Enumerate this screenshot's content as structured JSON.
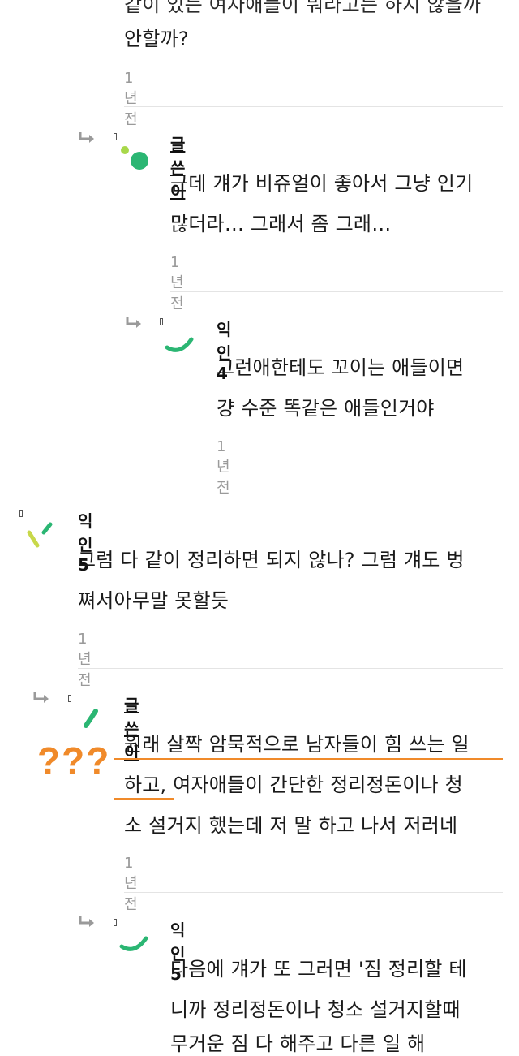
{
  "comment_top": {
    "lines": [
      "같이 있는 여자애들이 뭐라고는 하지 않을까",
      "안할까?"
    ],
    "time": "1년전"
  },
  "reply_1": {
    "author": "글쓴이",
    "lines": [
      "근데 걔가 비쥬얼이 좋아서 그냥 인기",
      "많더라… 그래서 좀 그래…"
    ],
    "time": "1년전"
  },
  "reply_2": {
    "author": "익인4",
    "lines": [
      "그런애한테도 꼬이는 애들이면",
      "걍 수준 똑같은 애들인거야"
    ],
    "time": "1년전"
  },
  "comment_5": {
    "author": "익인5",
    "lines": [
      "그럼 다 같이 정리하면 되지 않나? 그럼 걔도 벙",
      "쪄서아무말 못할듯"
    ],
    "time": "1년전"
  },
  "reply_3": {
    "author": "글쓴이",
    "lines": [
      "원래 살짝 암묵적으로 남자들이 힘 쓰는 일",
      "하고, 여자애들이 간단한 정리정돈이나 청",
      "소 설거지 했는데 저 말 하고 나서 저러네"
    ],
    "time": "1년전",
    "annotation": "???"
  },
  "reply_4": {
    "author": "익인5",
    "lines": [
      "다음에 걔가 또 그러면 '짐 정리할 테",
      "니까 정리정돈이나 청소 설거지할때",
      "무거운 짐 다 해주고 다른 일 해"
    ]
  },
  "colors": {
    "accent_green": "#2bb673",
    "lime": "#a8d84a",
    "annotation_orange": "#f08a2a"
  },
  "icons": [
    "reply-arrow-icon",
    "avatar-icon"
  ]
}
